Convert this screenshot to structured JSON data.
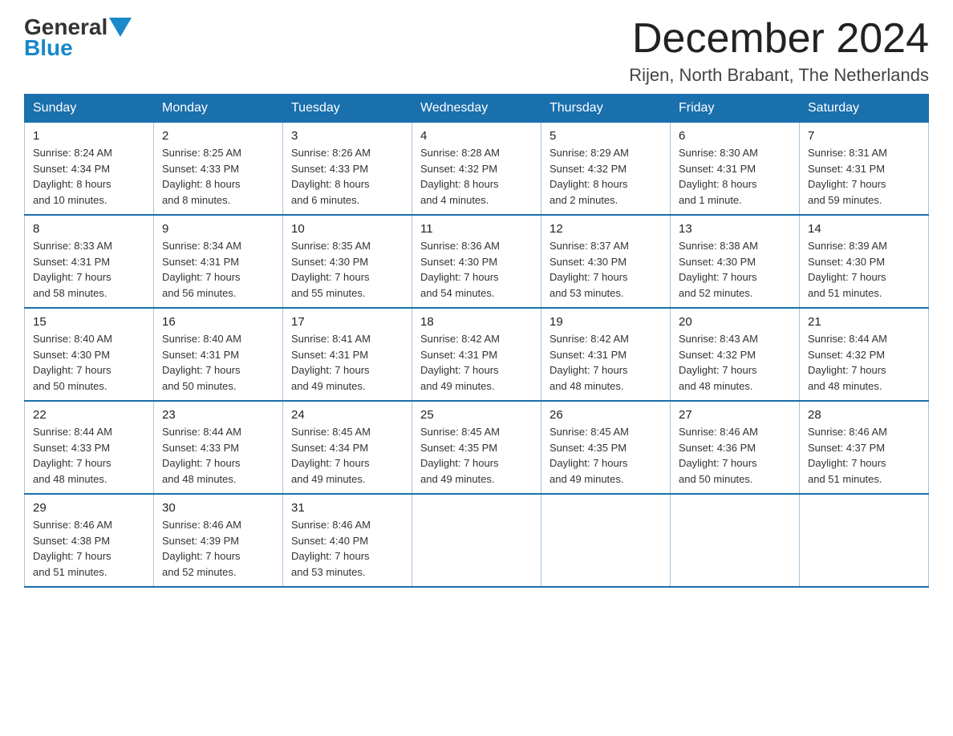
{
  "header": {
    "logo_general": "General",
    "logo_blue": "Blue",
    "month_title": "December 2024",
    "location": "Rijen, North Brabant, The Netherlands"
  },
  "days_of_week": [
    "Sunday",
    "Monday",
    "Tuesday",
    "Wednesday",
    "Thursday",
    "Friday",
    "Saturday"
  ],
  "weeks": [
    [
      {
        "day": "1",
        "sunrise": "8:24 AM",
        "sunset": "4:34 PM",
        "daylight": "8 hours and 10 minutes."
      },
      {
        "day": "2",
        "sunrise": "8:25 AM",
        "sunset": "4:33 PM",
        "daylight": "8 hours and 8 minutes."
      },
      {
        "day": "3",
        "sunrise": "8:26 AM",
        "sunset": "4:33 PM",
        "daylight": "8 hours and 6 minutes."
      },
      {
        "day": "4",
        "sunrise": "8:28 AM",
        "sunset": "4:32 PM",
        "daylight": "8 hours and 4 minutes."
      },
      {
        "day": "5",
        "sunrise": "8:29 AM",
        "sunset": "4:32 PM",
        "daylight": "8 hours and 2 minutes."
      },
      {
        "day": "6",
        "sunrise": "8:30 AM",
        "sunset": "4:31 PM",
        "daylight": "8 hours and 1 minute."
      },
      {
        "day": "7",
        "sunrise": "8:31 AM",
        "sunset": "4:31 PM",
        "daylight": "7 hours and 59 minutes."
      }
    ],
    [
      {
        "day": "8",
        "sunrise": "8:33 AM",
        "sunset": "4:31 PM",
        "daylight": "7 hours and 58 minutes."
      },
      {
        "day": "9",
        "sunrise": "8:34 AM",
        "sunset": "4:31 PM",
        "daylight": "7 hours and 56 minutes."
      },
      {
        "day": "10",
        "sunrise": "8:35 AM",
        "sunset": "4:30 PM",
        "daylight": "7 hours and 55 minutes."
      },
      {
        "day": "11",
        "sunrise": "8:36 AM",
        "sunset": "4:30 PM",
        "daylight": "7 hours and 54 minutes."
      },
      {
        "day": "12",
        "sunrise": "8:37 AM",
        "sunset": "4:30 PM",
        "daylight": "7 hours and 53 minutes."
      },
      {
        "day": "13",
        "sunrise": "8:38 AM",
        "sunset": "4:30 PM",
        "daylight": "7 hours and 52 minutes."
      },
      {
        "day": "14",
        "sunrise": "8:39 AM",
        "sunset": "4:30 PM",
        "daylight": "7 hours and 51 minutes."
      }
    ],
    [
      {
        "day": "15",
        "sunrise": "8:40 AM",
        "sunset": "4:30 PM",
        "daylight": "7 hours and 50 minutes."
      },
      {
        "day": "16",
        "sunrise": "8:40 AM",
        "sunset": "4:31 PM",
        "daylight": "7 hours and 50 minutes."
      },
      {
        "day": "17",
        "sunrise": "8:41 AM",
        "sunset": "4:31 PM",
        "daylight": "7 hours and 49 minutes."
      },
      {
        "day": "18",
        "sunrise": "8:42 AM",
        "sunset": "4:31 PM",
        "daylight": "7 hours and 49 minutes."
      },
      {
        "day": "19",
        "sunrise": "8:42 AM",
        "sunset": "4:31 PM",
        "daylight": "7 hours and 48 minutes."
      },
      {
        "day": "20",
        "sunrise": "8:43 AM",
        "sunset": "4:32 PM",
        "daylight": "7 hours and 48 minutes."
      },
      {
        "day": "21",
        "sunrise": "8:44 AM",
        "sunset": "4:32 PM",
        "daylight": "7 hours and 48 minutes."
      }
    ],
    [
      {
        "day": "22",
        "sunrise": "8:44 AM",
        "sunset": "4:33 PM",
        "daylight": "7 hours and 48 minutes."
      },
      {
        "day": "23",
        "sunrise": "8:44 AM",
        "sunset": "4:33 PM",
        "daylight": "7 hours and 48 minutes."
      },
      {
        "day": "24",
        "sunrise": "8:45 AM",
        "sunset": "4:34 PM",
        "daylight": "7 hours and 49 minutes."
      },
      {
        "day": "25",
        "sunrise": "8:45 AM",
        "sunset": "4:35 PM",
        "daylight": "7 hours and 49 minutes."
      },
      {
        "day": "26",
        "sunrise": "8:45 AM",
        "sunset": "4:35 PM",
        "daylight": "7 hours and 49 minutes."
      },
      {
        "day": "27",
        "sunrise": "8:46 AM",
        "sunset": "4:36 PM",
        "daylight": "7 hours and 50 minutes."
      },
      {
        "day": "28",
        "sunrise": "8:46 AM",
        "sunset": "4:37 PM",
        "daylight": "7 hours and 51 minutes."
      }
    ],
    [
      {
        "day": "29",
        "sunrise": "8:46 AM",
        "sunset": "4:38 PM",
        "daylight": "7 hours and 51 minutes."
      },
      {
        "day": "30",
        "sunrise": "8:46 AM",
        "sunset": "4:39 PM",
        "daylight": "7 hours and 52 minutes."
      },
      {
        "day": "31",
        "sunrise": "8:46 AM",
        "sunset": "4:40 PM",
        "daylight": "7 hours and 53 minutes."
      },
      null,
      null,
      null,
      null
    ]
  ],
  "labels": {
    "sunrise": "Sunrise:",
    "sunset": "Sunset:",
    "daylight": "Daylight:"
  }
}
